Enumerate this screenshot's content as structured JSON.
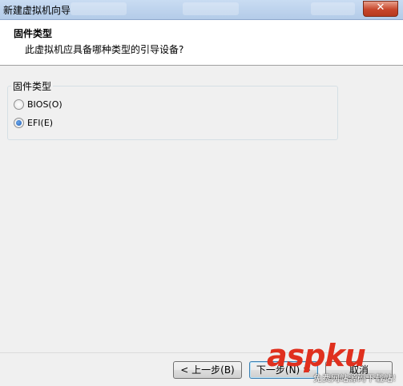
{
  "window": {
    "title": "新建虚拟机向导",
    "close_label": "✕"
  },
  "header": {
    "title": "固件类型",
    "subtitle": "此虚拟机应具备哪种类型的引导设备?"
  },
  "firmware_group": {
    "label": "固件类型",
    "options": [
      {
        "label": "BIOS(O)",
        "selected": false
      },
      {
        "label": "EFI(E)",
        "selected": true
      }
    ]
  },
  "footer": {
    "back_label": "< 上一步(B)",
    "next_label": "下一步(N) >",
    "cancel_label": "取消"
  },
  "watermark": {
    "brand": "aspku",
    "subtitle": "免费网站源码下载站!"
  }
}
